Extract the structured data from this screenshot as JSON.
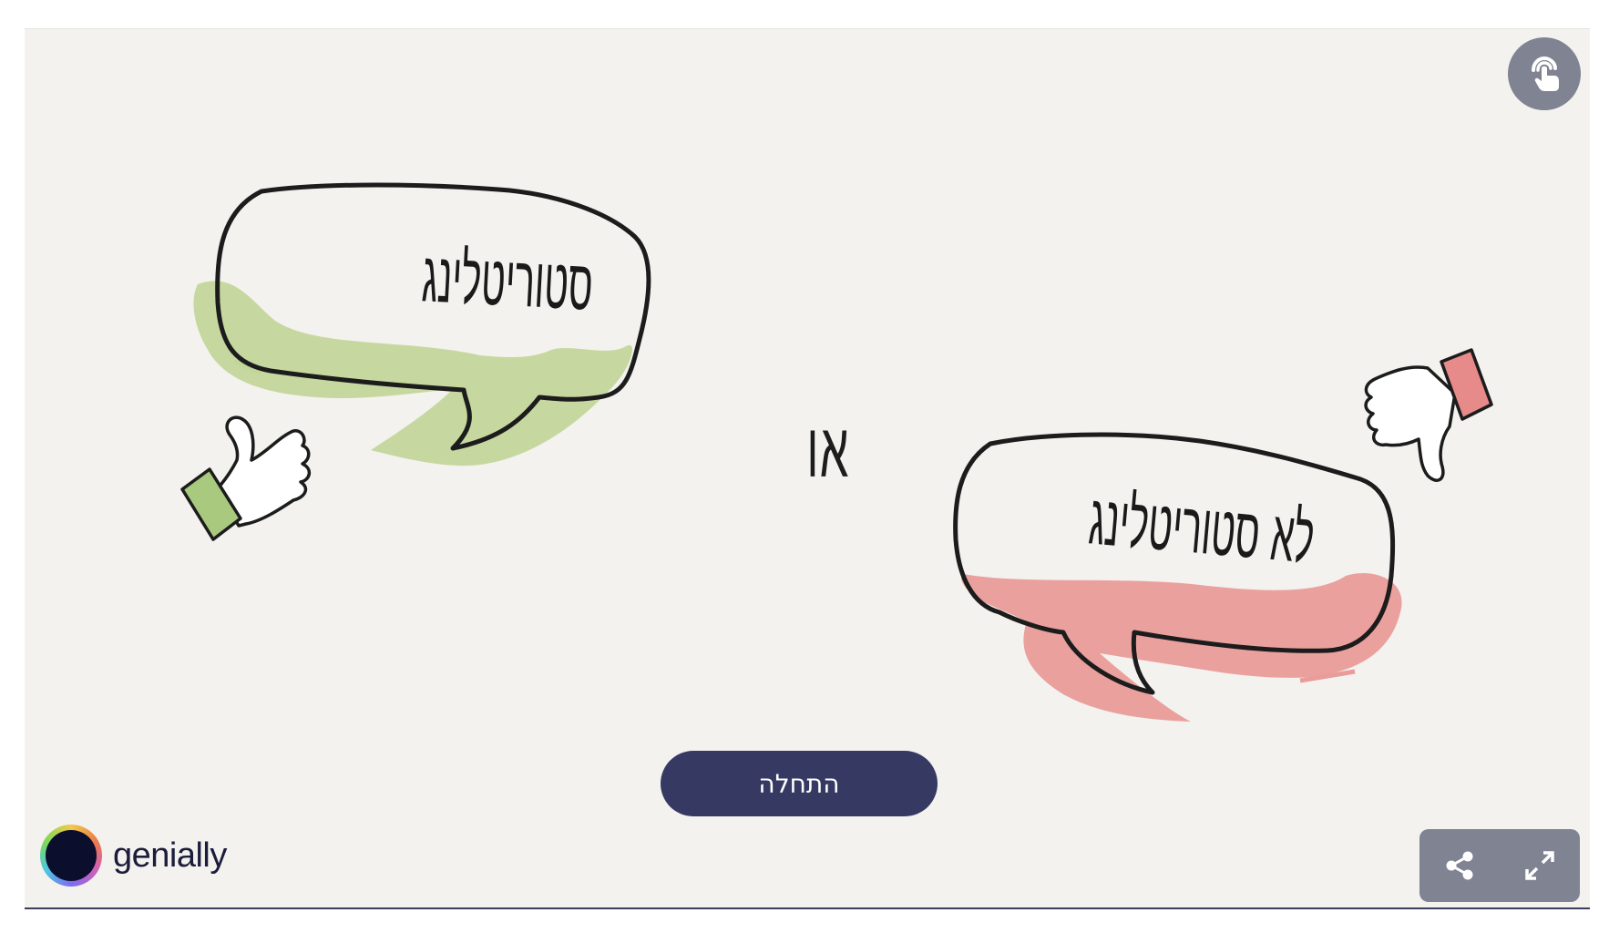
{
  "slide": {
    "bubble_left_text": "סטוריטלינג",
    "bubble_right_text": "לא סטוריטלינג",
    "or_word": "או",
    "start_label": "התחלה"
  },
  "brand": {
    "name": "genially"
  },
  "icons": {
    "gesture": "touch-pointer-icon",
    "share": "share-icon",
    "fullscreen": "expand-icon",
    "thumbs_up": "thumbs-up-icon",
    "thumbs_down": "thumbs-down-icon"
  },
  "colors": {
    "stage_bg": "#f3f2ef",
    "green_splash": "#c3d69a",
    "red_splash": "#e99c99",
    "button_bg": "#363a63",
    "controls_bg": "#7f8392"
  }
}
